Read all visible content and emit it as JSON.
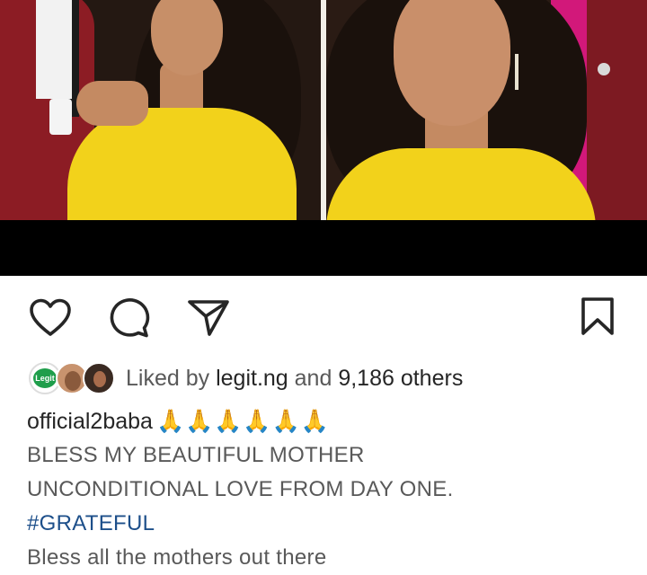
{
  "post": {
    "image": {
      "description_icon": "photo-icon"
    },
    "actions": {
      "like_icon": "heart-icon",
      "comment_icon": "comment-bubble-icon",
      "share_icon": "paper-plane-icon",
      "save_icon": "bookmark-icon"
    },
    "likes": {
      "prefix": "Liked by",
      "first_liker": "legit.ng",
      "connector": "and",
      "others_count": "9,186 others",
      "avatar_badge_text": "Legit"
    },
    "caption": {
      "username": "official2baba",
      "emoji": "🙏🙏🙏🙏🙏🙏",
      "lines": [
        "BLESS MY BEAUTIFUL MOTHER",
        "UNCONDITIONAL LOVE FROM DAY ONE."
      ],
      "hashtag": "#GRATEFUL",
      "last_line": "Bless all the mothers out there"
    }
  },
  "colors": {
    "text": "#262626",
    "muted": "#595959",
    "hashtag": "#1d4f8a",
    "dress_yellow": "#f2d21b"
  }
}
